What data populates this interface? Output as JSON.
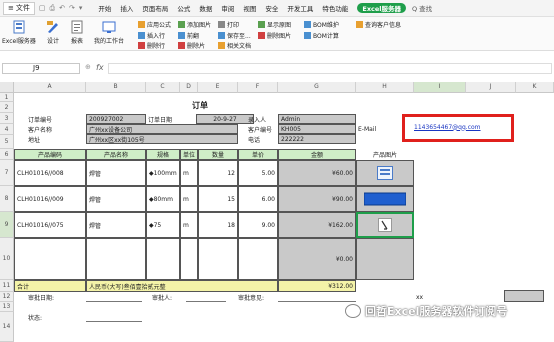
{
  "menubar": {
    "file": "文件",
    "tabs": [
      "开始",
      "插入",
      "页面布局",
      "公式",
      "数据",
      "审阅",
      "视图",
      "安全",
      "开发工具",
      "特色功能"
    ],
    "excel_server": "Excel服务器",
    "search": "Q 查找"
  },
  "ribbon": {
    "big": [
      "Excel服务器",
      "设计",
      "报表",
      "我的工作台"
    ],
    "small_col1": [
      "应用公式",
      "插入行",
      "删除行"
    ],
    "small_col2": [
      "添加图片",
      "前翻",
      "删除片"
    ],
    "small_col3": [
      "打印",
      "保存至...",
      "相关文档"
    ],
    "small_col4": [
      "显示原图",
      "删除图片"
    ],
    "small_col5": [
      "BOM维护",
      "BOM计算"
    ],
    "small_col6": [
      "查询客户信息"
    ]
  },
  "formula": {
    "cell_ref": "J9",
    "fx": "fx",
    "value": ""
  },
  "columns": [
    "A",
    "B",
    "C",
    "D",
    "E",
    "F",
    "G",
    "H",
    "I",
    "J",
    "K",
    "L"
  ],
  "rows": [
    "1",
    "2",
    "3",
    "4",
    "5",
    "6",
    "7",
    "8",
    "9",
    "10",
    "11",
    "12",
    "13",
    "14"
  ],
  "form": {
    "title": "订单",
    "order_no_label": "订单编号",
    "order_no": "200927002",
    "order_date_label": "订单日期",
    "order_date": "20-9-27",
    "entry_person_label": "录入人",
    "entry_person": "Admin",
    "customer_label": "客户名称",
    "customer": "广州xx设备公司",
    "customer_no_label": "客户编号",
    "customer_no": "KH005",
    "address_label": "地址",
    "address": "广州xx区xx街105号",
    "phone_label": "电话",
    "phone": "222222",
    "email_label": "E-Mail",
    "email": "1143654467@qq.com",
    "headers": [
      "产品编码",
      "产品名称",
      "规格",
      "单位",
      "数量",
      "单价",
      "金额"
    ],
    "image_header": "产品图片",
    "items": [
      {
        "code": "CLH01016//008",
        "name": "焊管",
        "spec": "◆100mm",
        "unit": "m",
        "qty": "12",
        "price": "5.00",
        "amount": "¥60.00"
      },
      {
        "code": "CLH01016//009",
        "name": "焊管",
        "spec": "◆80mm",
        "unit": "m",
        "qty": "15",
        "price": "6.00",
        "amount": "¥90.00"
      },
      {
        "code": "CLH01016//075",
        "name": "焊管",
        "spec": "◆75",
        "unit": "m",
        "qty": "18",
        "price": "9.00",
        "amount": "¥162.00"
      }
    ],
    "empty_amount": "¥0.00",
    "total_label": "合计",
    "total_words": "人民币(大写)叁佰壹拾贰元整",
    "total_amount": "¥312.00",
    "approve_date_label": "审批日期:",
    "approver_label": "审批人:",
    "approve_opinion_label": "审批意见:",
    "xx": "xx",
    "status_label": "状态:"
  },
  "watermark": "回哲Excel服务器软件订阅号"
}
